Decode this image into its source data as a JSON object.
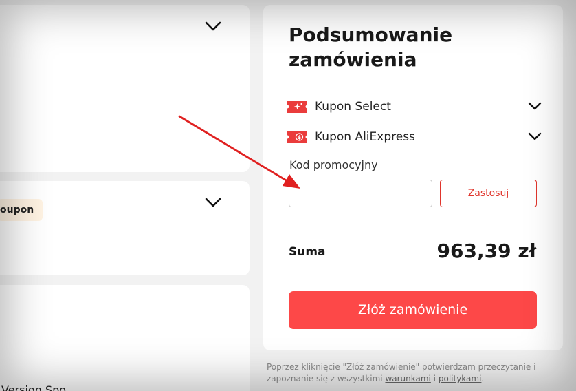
{
  "summary": {
    "title": "Podsumowanie zamówienia",
    "coupons": [
      {
        "label": "Kupon Select",
        "icon": "select-coupon-icon"
      },
      {
        "label": "Kupon AliExpress",
        "icon": "aliexpress-coupon-icon"
      }
    ],
    "promo": {
      "label": "Kod promocyjny",
      "value": "",
      "apply_label": "Zastosuj"
    },
    "total": {
      "label": "Suma",
      "value": "963,39 zł"
    },
    "order_button_label": "Złóż zamówienie",
    "legal": {
      "text_before": "Poprzez kliknięcie \"Złóż zamówienie\" potwierdzam przeczytanie i zapoznanie się z wszystkimi ",
      "terms_link": "warunkami",
      "conjunction": " i ",
      "policies_link": "politykami",
      "text_after": "."
    }
  },
  "left": {
    "coupon_pill": "oupon",
    "bottom_text": "Version Spo"
  },
  "colors": {
    "accent": "#fd4848",
    "accent_border": "#e0352c",
    "arrow": "#e02020",
    "pill_bg": "#fff3e3"
  }
}
